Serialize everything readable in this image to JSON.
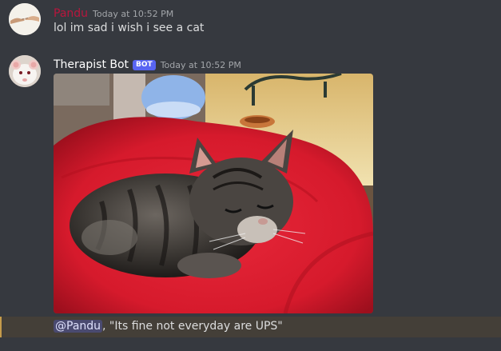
{
  "messages": [
    {
      "author": "Pandu",
      "author_color": "#b8163d",
      "timestamp": "Today at 10:52 PM",
      "content": "lol im sad i wish i see a cat",
      "avatar_icon": "creation-of-adam-hands-icon"
    },
    {
      "author": "Therapist Bot",
      "author_color": "#ffffff",
      "bot_tag": "BOT",
      "timestamp": "Today at 10:52 PM",
      "attachment": "tabby-kitten-sleeping-on-red-cushion-image",
      "avatar_icon": "white-rat-icon",
      "mention": "@Pandu",
      "reply_text": ", \"Its fine not everyday are UPS\""
    }
  ],
  "colors": {
    "background": "#36393f",
    "text": "#dcddde",
    "timestamp": "#a3a6aa",
    "bot_tag": "#5865f2",
    "mention_highlight": "#443f38"
  }
}
